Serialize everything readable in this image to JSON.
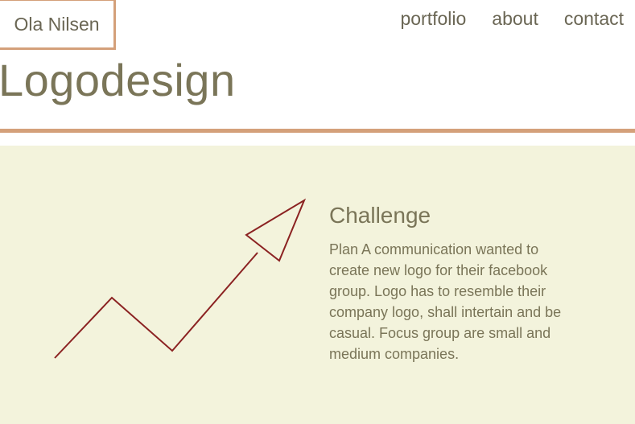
{
  "header": {
    "brand": "Ola Nilsen",
    "nav": [
      {
        "label": "portfolio"
      },
      {
        "label": "about"
      },
      {
        "label": "contact"
      }
    ]
  },
  "page": {
    "title": "Logodesign"
  },
  "main": {
    "illustration_icon": "zigzag-arrow-icon",
    "challenge_heading": "Challenge",
    "challenge_text": "Plan A communication wanted to create new logo for their facebook group. Logo has to resemble their company logo, shall intertain and be casual. Focus group are small and medium companies."
  },
  "colors": {
    "accent": "#d4a07a",
    "content_background": "#f3f3dc",
    "arrow": "#8b2222",
    "text": "#7a7558"
  }
}
